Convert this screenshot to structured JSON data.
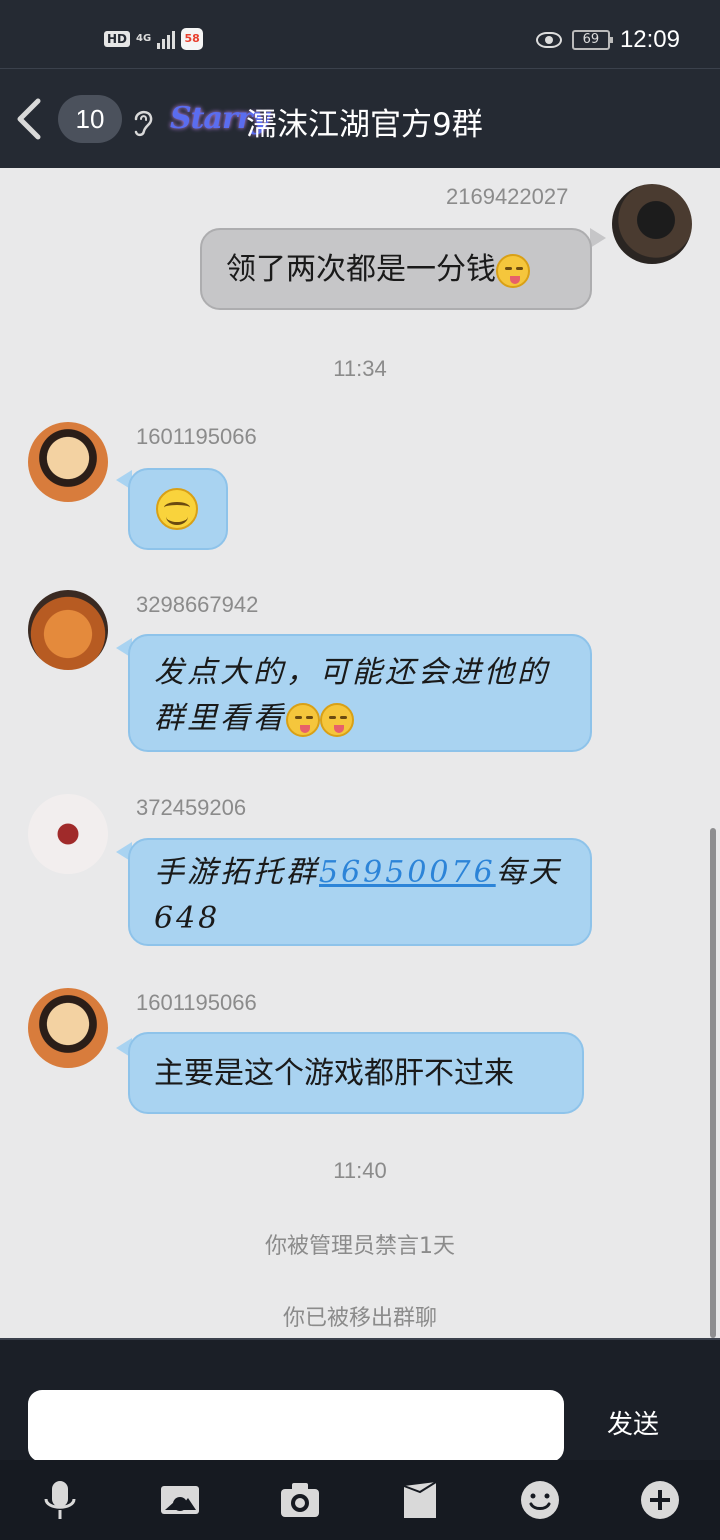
{
  "status_bar": {
    "hd": "HD",
    "network": "4G",
    "app_badge": "58",
    "battery": "69",
    "time": "12:09"
  },
  "header": {
    "unread_count": "10",
    "logo_text": "Starry",
    "group_name": "濡沫江湖官方9群"
  },
  "messages": [
    {
      "sender": "2169422027",
      "text": "领了两次都是一分钱",
      "direction": "out"
    },
    {
      "type": "time",
      "text": "11:34"
    },
    {
      "sender": "1601195066",
      "text": "",
      "emoji": "smile-emoji",
      "direction": "in"
    },
    {
      "sender": "3298667942",
      "line1": "发点大的，可能还会进他的",
      "line2": "群里看看",
      "direction": "in"
    },
    {
      "sender": "372459206",
      "prefix": "手游拓托群",
      "link": "56950076",
      "suffix": "每天",
      "line2": "648",
      "direction": "in"
    },
    {
      "sender": "1601195066",
      "text": "主要是这个游戏都肝不过来",
      "direction": "in"
    },
    {
      "type": "time",
      "text": "11:40"
    },
    {
      "type": "system",
      "text": "你被管理员禁言1天"
    },
    {
      "type": "system",
      "text": "你已被移出群聊"
    }
  ],
  "input": {
    "value": "",
    "send_label": "发送"
  },
  "toolbar": [
    "mic-icon",
    "image-icon",
    "camera-icon",
    "file-icon",
    "emoji-icon",
    "plus-icon"
  ],
  "colors": {
    "bar_bg": "#252a33",
    "chat_bg": "#e9e9ea",
    "bubble_in": "#a9d3f1",
    "bubble_out": "#c6c6c8",
    "link": "#2c84d8"
  }
}
